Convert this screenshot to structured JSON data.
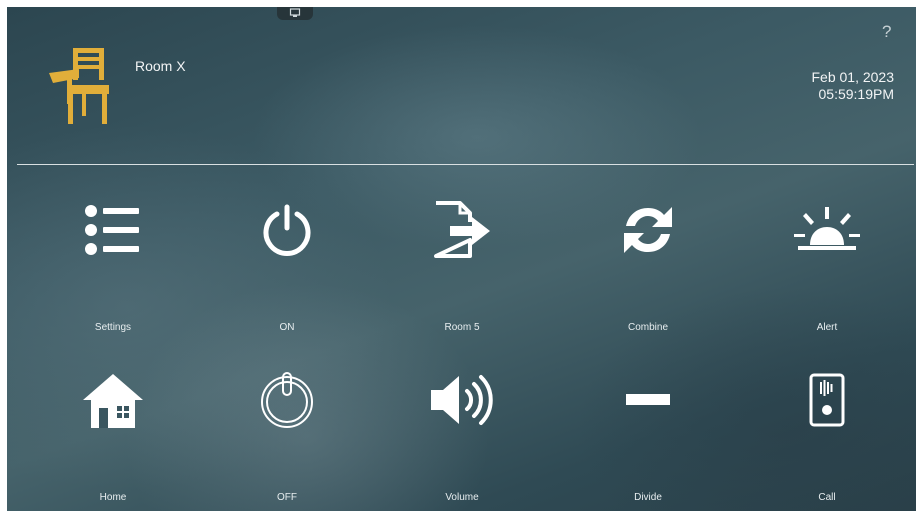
{
  "header": {
    "room_name": "Room X",
    "date": "Feb 01, 2023",
    "time": "05:59:19PM",
    "help_label": "?"
  },
  "colors": {
    "logo": "#e1ae3a",
    "icon": "#ffffff",
    "label": "#e8eef0"
  },
  "buttons": [
    {
      "label": "Settings",
      "icon": "list-icon"
    },
    {
      "label": "ON",
      "icon": "power-on-icon"
    },
    {
      "label": "Room 5",
      "icon": "file-export-icon"
    },
    {
      "label": "Combine",
      "icon": "refresh-arrows-icon"
    },
    {
      "label": "Alert",
      "icon": "alarm-light-icon"
    },
    {
      "label": "Home",
      "icon": "house-icon"
    },
    {
      "label": "OFF",
      "icon": "power-off-icon"
    },
    {
      "label": "Volume",
      "icon": "speaker-icon"
    },
    {
      "label": "Divide",
      "icon": "minus-icon"
    },
    {
      "label": "Call",
      "icon": "intercom-icon"
    }
  ]
}
